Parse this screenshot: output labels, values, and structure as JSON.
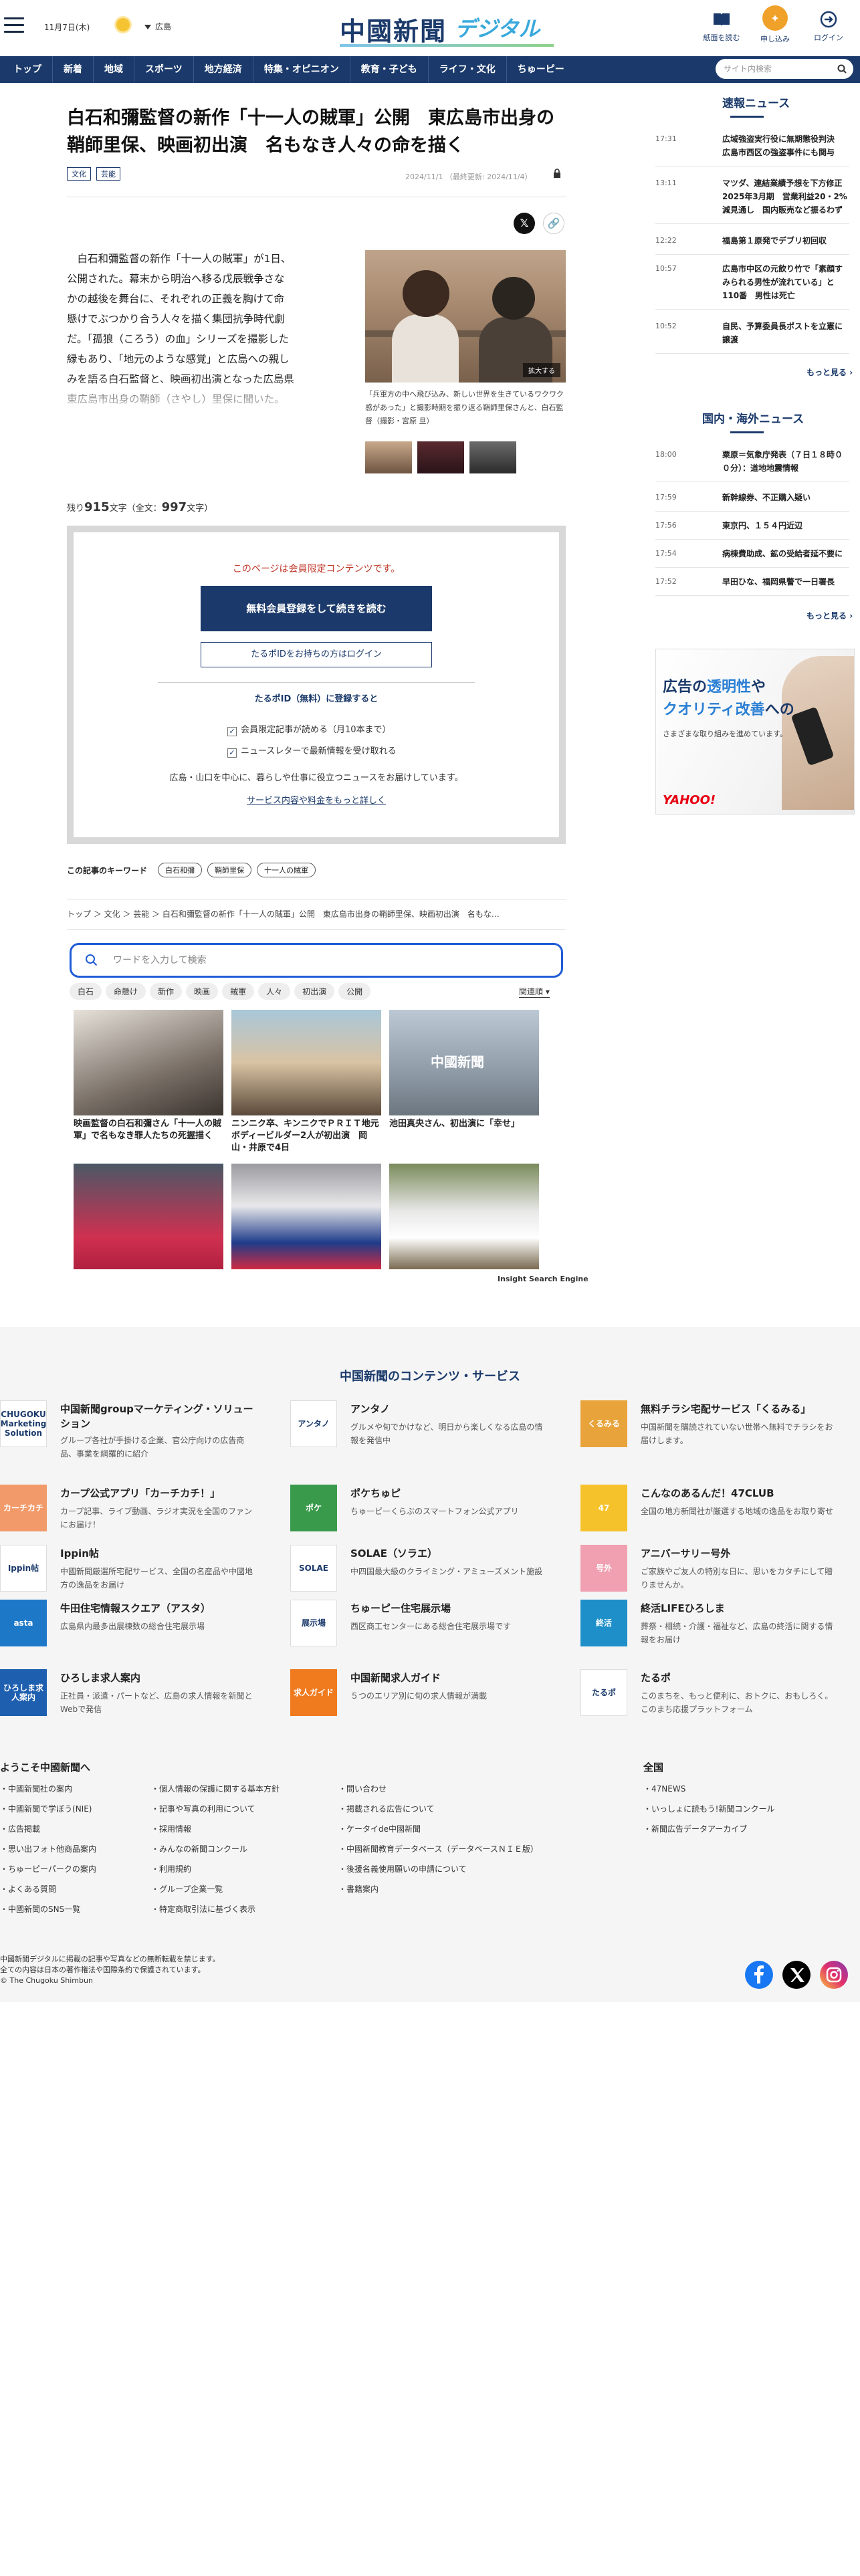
{
  "header": {
    "date": "11月7日(木)",
    "area": "広島",
    "logo_main": "中國新聞",
    "logo_sub": "デジタル",
    "buttons": [
      {
        "label": "紙面を読む",
        "icon": "newspaper-icon"
      },
      {
        "label": "申し込み",
        "icon": "apply-icon"
      },
      {
        "label": "ログイン",
        "icon": "login-icon"
      }
    ],
    "search_placeholder": "サイト内検索"
  },
  "nav": [
    "トップ",
    "新着",
    "地域",
    "スポーツ",
    "地方経済",
    "特集・オピニオン",
    "教育・子ども",
    "ライフ・文化",
    "ちゅーピー"
  ],
  "article": {
    "title": "白石和彌監督の新作「十一人の賊軍」公開　東広島市出身の鞘師里保、映画初出演　名もなき人々の命を描く",
    "tags": [
      "文化",
      "芸能"
    ],
    "date": "2024/11/1 （最終更新: 2024/11/4）",
    "body": "白石和彌監督の新作「十一人の賊軍」が1日、公開された。幕末から明治へ移る戊辰戦争さなかの越後を舞台に、それぞれの正義を胸けて命懸けでぶつかり合う人々を描く集団抗争時代劇だ。「孤狼（ころう）の血」シリーズを撮影した縁もあり、「地元のような感覚」と広島への親しみを語る白石監督と、映画初出演となった広島県東広島市出身の鞘師（さやし）里保に聞いた。",
    "photo_enlarge": "拡大する",
    "caption": "「兵軍方の中へ飛び込み、新しい世界を生きているワクワク感があった」と撮影時期を振り返る鞘師里保さんと、白石監督（撮影・宮原 旦）",
    "remain_prefix": "残り",
    "remain_count": "915",
    "remain_mid": "文字（全文：",
    "total_count": "997",
    "remain_suffix": "文字）"
  },
  "paywall": {
    "limited": "このページは会員限定コンテンツです。",
    "register_button": "無料会員登録をして続きを読む",
    "login_button": "たるポIDをお持ちの方はログイン",
    "taru_heading": "たるポID（無料）に登録すると",
    "benefits": [
      "会員限定記事が読める（月10本まで）",
      "ニュースレターで最新情報を受け取れる"
    ],
    "delivery": "広島・山口を中心に、暮らしや仕事に役立つニュースをお届けしています。",
    "service_link": "サービス内容や料金をもっと詳しく"
  },
  "keywords": {
    "label": "この記事のキーワード",
    "items": [
      "白石和彌",
      "鞘師里保",
      "十一人の賊軍"
    ]
  },
  "breadcrumb": "トップ ＞ 文化 ＞ 芸能 ＞ 白石和彌監督の新作「十一人の賊軍」公開　東広島市出身の鞘師里保、映画初出演　名もな…",
  "insight": {
    "placeholder": "ワードを入力して検索",
    "chips": [
      "白石",
      "命懸け",
      "新作",
      "映画",
      "賊軍",
      "人々",
      "初出演",
      "公開"
    ],
    "sort": "関連順",
    "cards": [
      {
        "title": "映画監督の白石和彌さん「十一人の賊軍」で名もなき罪人たちの死握描く"
      },
      {
        "title": "ニンニク卒、キンニクでＰＲＩＴ地元ボディービルダー2人が初出演　岡山・井原で4日"
      },
      {
        "title": "池田真央さん、初出演に「幸せ」"
      },
      {
        "title": ""
      },
      {
        "title": ""
      },
      {
        "title": ""
      }
    ],
    "engine": "Insight Search Engine"
  },
  "sidebar": {
    "breaking_title": "速報ニュース",
    "breaking": [
      {
        "time": "17:31",
        "text": "広域強盗実行役に無期懲役判決　広島市西区の強盗事件にも関与"
      },
      {
        "time": "13:11",
        "text": "マツダ、連結業績予想を下方修正　2025年3月期　営業利益20・2%減見通し　国内販売など振るわず"
      },
      {
        "time": "12:22",
        "text": "福島第１原発でデブリ初回収"
      },
      {
        "time": "10:57",
        "text": "広島市中区の元飲り竹で「素顔すみられる男性が流れている」と110番　男性は死亡"
      },
      {
        "time": "10:52",
        "text": "自民、予算委員長ポストを立憲に譲渡"
      }
    ],
    "more1": "もっと見る",
    "national_title": "国内・海外ニュース",
    "national": [
      {
        "time": "18:00",
        "text": "粟原＝気象庁発表（７日１８時００分）：道地地震情報"
      },
      {
        "time": "17:59",
        "text": "新幹線券、不正購入疑い"
      },
      {
        "time": "17:56",
        "text": "東京円、１５４円近辺"
      },
      {
        "time": "17:54",
        "text": "病棟費助成、鉱の受給者延不要に"
      },
      {
        "time": "17:52",
        "text": "早田ひな、福岡県警で一日署長"
      }
    ],
    "more2": "もっと見る",
    "ad_line1a": "広告の",
    "ad_line1b": "透明性",
    "ad_line1c": "や",
    "ad_line2a": "クオリティ改善",
    "ad_line2b": "への",
    "ad_line3": "さまざまな取り組みを進めています。",
    "ad_brand": "YAHOO!"
  },
  "footer": {
    "heading": "中国新聞のコンテンツ・サービス",
    "services": [
      {
        "name": "中国新聞groupマーケティング・ソリューション",
        "desc": "グループ各社が手掛ける企業、官公庁向けの広告商品、事業を網羅的に紹介",
        "logo": "CHUGOKU Marketing Solution",
        "color": "#ffffff"
      },
      {
        "name": "アンタノ",
        "desc": "グルメや旬でかけなど、明日から楽しくなる広島の情報を発信中",
        "logo": "アンタノ",
        "color": "#ffffff"
      },
      {
        "name": "無料チラシ宅配サービス「くるみる」",
        "desc": "中国新聞を購読されていない世帯へ無料でチラシをお届けします。",
        "logo": "くるみる",
        "color": "#e8a33a"
      },
      {
        "name": "カープ公式アプリ「カーチカチ！」",
        "desc": "カープ記事、ライブ動画、ラジオ実況を全国のファンにお届け！",
        "logo": "カーチカチ",
        "color": "#f29a6a"
      },
      {
        "name": "ポケちゅピ",
        "desc": "ちゅーピーくらぶのスマートフォン公式アプリ",
        "logo": "ポケ",
        "color": "#3a9a4b"
      },
      {
        "name": "こんなのあるんだ！47CLUB",
        "desc": "全国の地方新聞社が厳選する地域の逸品をお取り寄せ",
        "logo": "47",
        "color": "#f6c22b"
      },
      {
        "name": "Ippin帖",
        "desc": "中國新聞厳選所宅配サービス、全国の名産品や中國地方の逸品をお届け",
        "logo": "Ippin帖",
        "color": "#ffffff"
      },
      {
        "name": "SOLAE（ソラエ）",
        "desc": "中四国最大級のクライミング・アミューズメント施設",
        "logo": "SOLAE",
        "color": "#ffffff"
      },
      {
        "name": "アニバーサリー号外",
        "desc": "ご家族やご友人の特別な日に、思いをカタチにして贈りませんか。",
        "logo": "号外",
        "color": "#f0a0b0"
      },
      {
        "name": "牛田住宅情報スクエア（アスタ）",
        "desc": "広島県内最多出展棟数の総合住宅展示場",
        "logo": "asta",
        "color": "#1e78c8"
      },
      {
        "name": "ちゅーピー住宅展示場",
        "desc": "西区商工センターにある総合住宅展示場です",
        "logo": "展示場",
        "color": "#ffffff"
      },
      {
        "name": "終活LIFEひろしま",
        "desc": "葬祭・相続・介護・福祉など、広島の終活に関する情報をお届け",
        "logo": "終活",
        "color": "#1e8fc8"
      },
      {
        "name": "ひろしま求人案内",
        "desc": "正社員・派遣・パートなど、広島の求人情報を新聞とWebで発信",
        "logo": "ひろしま求人案内",
        "color": "#1e5fb0"
      },
      {
        "name": "中国新聞求人ガイド",
        "desc": "５つのエリア別に旬の求人情報が満載",
        "logo": "求人ガイド",
        "color": "#f07a1e"
      },
      {
        "name": "たるポ",
        "desc": "このまちを、もっと便利に、おトクに、おもしろく。このまち応援プラットフォーム",
        "logo": "たるポ",
        "color": "#ffffff"
      }
    ],
    "welcome": "ようこそ中國新聞へ",
    "col1": [
      "中國新聞社の案内",
      "中國新聞で学ぼう(NIE)",
      "広告掲載",
      "思い出フォト他商品案内",
      "ちゅーピーパークの案内",
      "よくある質問",
      "中國新聞のSNS一覧"
    ],
    "col2": [
      "個人情報の保護に関する基本方針",
      "記事や写真の利用について",
      "採用情報",
      "みんなの新聞コンクール",
      "利用規約",
      "グループ企業一覧",
      "特定商取引法に基づく表示"
    ],
    "col3": [
      "問い合わせ",
      "掲載される広告について",
      "ケータイde中國新聞",
      "中國新聞教育データベース（データベースＮＩＥ版）",
      "後援名義使用願いの申請について",
      "書籍案内"
    ],
    "national": "全国",
    "col4": [
      "47NEWS",
      "いっしょに読もう!新聞コンクール",
      "新聞広告データアーカイブ"
    ],
    "copy1": "中國新聞デジタルに掲載の記事や写真などの無断転載を禁じます。",
    "copy2": "全ての内容は日本の著作権法や国際条約で保護されています。",
    "copy3": "© The Chugoku Shimbun"
  },
  "colors": {
    "brand": "#1b3a6b",
    "accent": "#39a9dc",
    "apply": "#f0a12a",
    "red": "#c0392b"
  }
}
